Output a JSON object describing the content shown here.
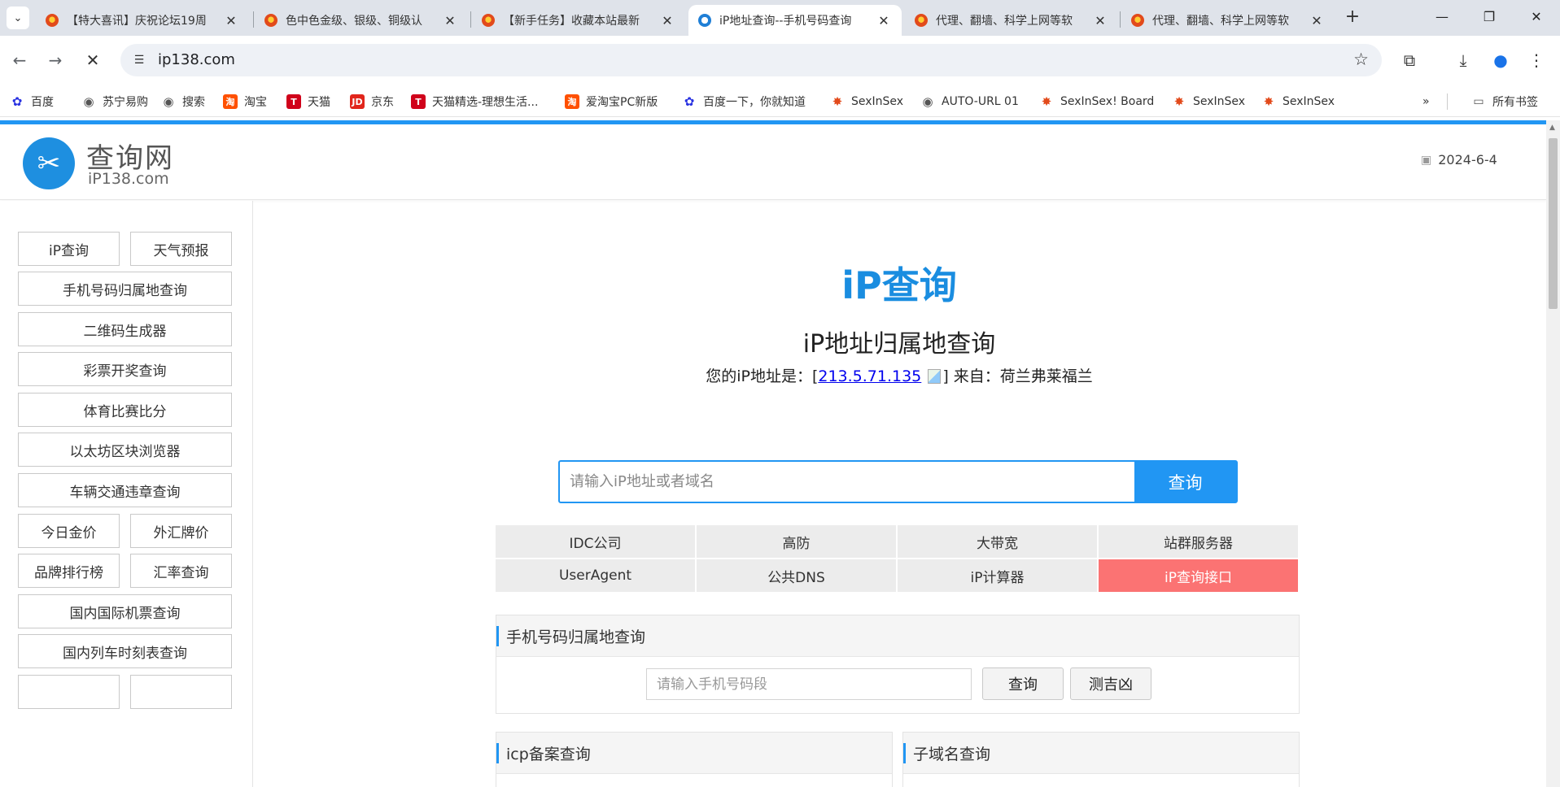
{
  "browser": {
    "tabs": [
      {
        "title": "【特大喜讯】庆祝论坛19周",
        "active": false,
        "favicon": "bug-icon"
      },
      {
        "title": "色中色金级、银级、铜级认",
        "active": false,
        "favicon": "bug-icon"
      },
      {
        "title": "【新手任务】收藏本站最新",
        "active": false,
        "favicon": "bug-icon"
      },
      {
        "title": "iP地址查询--手机号码查询",
        "active": true,
        "favicon": "ip-icon"
      },
      {
        "title": "代理、翻墙、科学上网等软",
        "active": false,
        "favicon": "bug-icon"
      },
      {
        "title": "代理、翻墙、科学上网等软",
        "active": false,
        "favicon": "bug-icon"
      }
    ],
    "url": "ip138.com",
    "bookmarks": [
      {
        "label": "百度",
        "icon": "baidu-icon",
        "color": "#2932e1"
      },
      {
        "label": "苏宁易购",
        "icon": "globe-icon",
        "color": "#555555"
      },
      {
        "label": "搜索",
        "icon": "globe-icon",
        "color": "#555555"
      },
      {
        "label": "淘宝",
        "icon": "taobao-icon",
        "color": "#ff5000"
      },
      {
        "label": "天猫",
        "icon": "tmall-icon",
        "color": "#d0021b"
      },
      {
        "label": "京东",
        "icon": "jd-icon",
        "color": "#e1251b"
      },
      {
        "label": "天猫精选-理想生活...",
        "icon": "tmall-icon",
        "color": "#d0021b"
      },
      {
        "label": "爱淘宝PC新版",
        "icon": "taobao-icon",
        "color": "#ff5000"
      },
      {
        "label": "百度一下，你就知道",
        "icon": "baidu-icon",
        "color": "#2932e1"
      },
      {
        "label": "SexInSex",
        "icon": "bug-icon",
        "color": "#e24a1b"
      },
      {
        "label": "AUTO-URL 01",
        "icon": "globe-icon",
        "color": "#555555"
      },
      {
        "label": "SexInSex! Board",
        "icon": "bug-icon",
        "color": "#e24a1b"
      },
      {
        "label": "SexInSex",
        "icon": "bug-icon",
        "color": "#e24a1b"
      },
      {
        "label": "SexInSex",
        "icon": "bug-icon",
        "color": "#e24a1b"
      }
    ],
    "all_bookmarks": "所有书签"
  },
  "site": {
    "logo_cn": "查询网",
    "logo_en": "iP138.com",
    "date": "2024-6-4",
    "accent_color": "#2196f3"
  },
  "sidebar": {
    "items": [
      {
        "label": "iP查询",
        "active": true
      },
      {
        "label": "天气预报",
        "active": false
      },
      {
        "label": "手机号码归属地查询",
        "active": false
      },
      {
        "label": "二维码生成器",
        "active": false
      },
      {
        "label": "彩票开奖查询",
        "active": false
      },
      {
        "label": "体育比赛比分",
        "active": false
      },
      {
        "label": "以太坊区块浏览器",
        "active": false
      },
      {
        "label": "车辆交通违章查询",
        "active": false
      },
      {
        "label": "今日金价",
        "active": false
      },
      {
        "label": "外汇牌价",
        "active": false
      },
      {
        "label": "品牌排行榜",
        "active": false
      },
      {
        "label": "汇率查询",
        "active": false
      },
      {
        "label": "国内国际机票查询",
        "active": false
      },
      {
        "label": "国内列车时刻表查询",
        "active": false
      }
    ]
  },
  "main": {
    "logo_text": "iP查询",
    "title": "iP地址归属地查询",
    "ip_prefix": "您的iP地址是：[",
    "ip_address": "213.5.71.135",
    "ip_suffix": "] 来自：荷兰弗莱福兰",
    "search_placeholder": "请输入iP地址或者域名",
    "search_button": "查询",
    "quick_links": [
      {
        "label": "IDC公司",
        "highlight": false
      },
      {
        "label": "高防",
        "highlight": false
      },
      {
        "label": "大带宽",
        "highlight": false
      },
      {
        "label": "站群服务器",
        "highlight": false
      },
      {
        "label": "UserAgent",
        "highlight": false
      },
      {
        "label": "公共DNS",
        "highlight": false
      },
      {
        "label": "iP计算器",
        "highlight": false
      },
      {
        "label": "iP查询接口",
        "highlight": true
      }
    ],
    "highlight_color": "#fb7373"
  },
  "phone_panel": {
    "title": "手机号码归属地查询",
    "placeholder": "请输入手机号码段",
    "query_button": "查询",
    "fortune_button": "测吉凶"
  },
  "icp_panel": {
    "title": "icp备案查询"
  },
  "subdomain_panel": {
    "title": "子域名查询"
  }
}
